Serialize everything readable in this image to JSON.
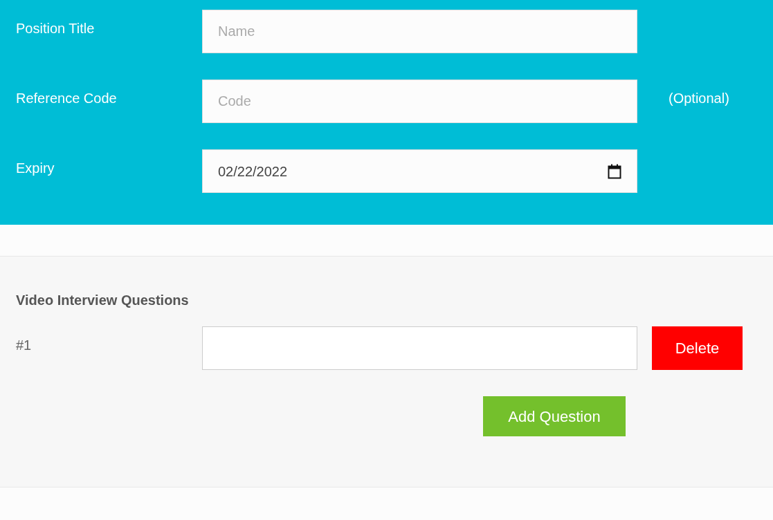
{
  "position_form": {
    "fields": [
      {
        "kind": "text",
        "label": "Position Title",
        "placeholder": "Name"
      },
      {
        "kind": "text",
        "label": "Reference Code",
        "placeholder": "Code",
        "note": "(Optional)"
      },
      {
        "kind": "date",
        "label": "Expiry",
        "value": "02/22/2022"
      }
    ]
  },
  "questions_section": {
    "title": "Video Interview Questions",
    "questions": [
      {
        "label": "#1",
        "delete_button": "Delete"
      }
    ],
    "add_button": "Add Question"
  }
}
